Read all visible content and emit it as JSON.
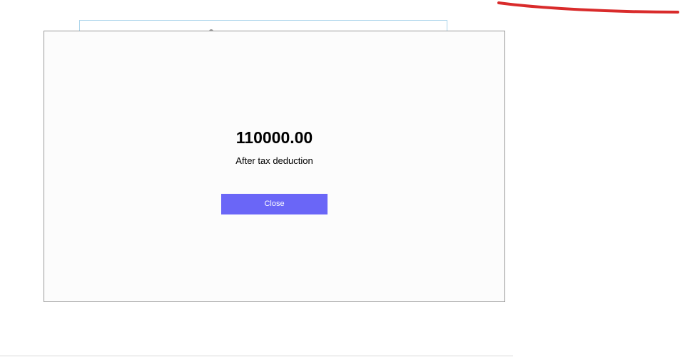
{
  "modal": {
    "amount": "110000.00",
    "subtitle": "After tax deduction",
    "close_label": "Close"
  },
  "colors": {
    "button_bg": "#6a66f7",
    "button_text": "#ffffff",
    "modal_bg": "#fcfcfc",
    "modal_border": "#999999",
    "annotation_stroke": "#d92b2b",
    "background_card_border": "#a9d3ea"
  }
}
